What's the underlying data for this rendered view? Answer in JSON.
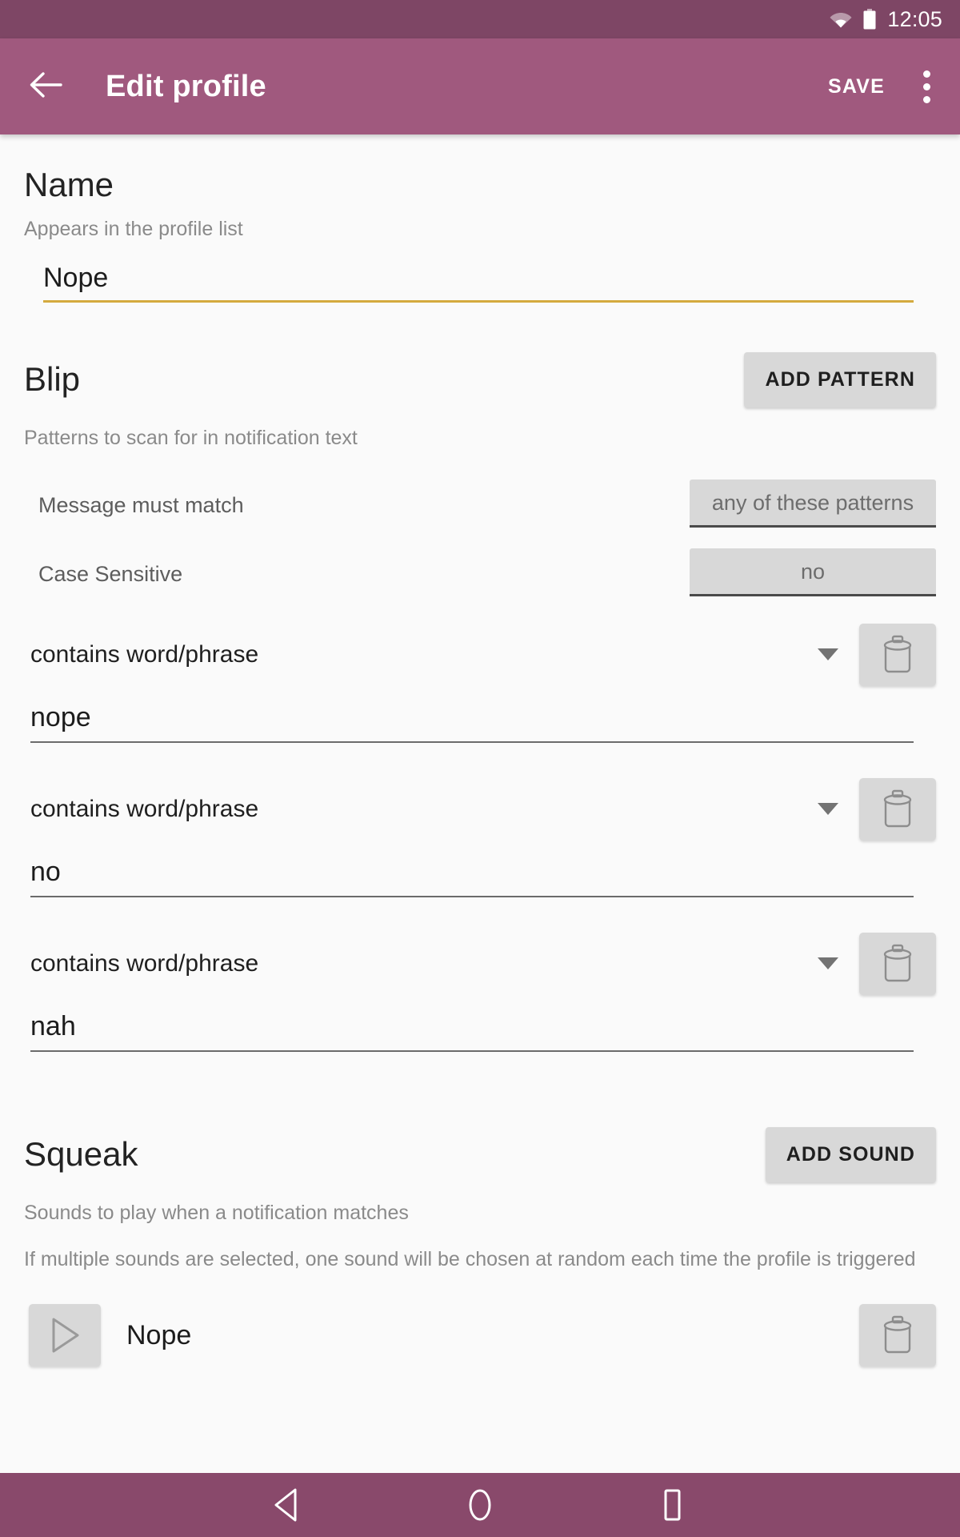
{
  "status_bar": {
    "time": "12:05",
    "wifi_icon": "wifi-icon",
    "battery_icon": "battery-icon"
  },
  "app_bar": {
    "back_icon": "back-arrow-icon",
    "title": "Edit profile",
    "save_label": "SAVE",
    "overflow_icon": "overflow-menu-icon",
    "background_color": "#a0597e"
  },
  "name_section": {
    "title": "Name",
    "subtitle": "Appears in the profile list",
    "value": "Nope",
    "placeholder": "Name",
    "underline_color": "#d4aa3e"
  },
  "blip_section": {
    "title": "Blip",
    "add_button_label": "ADD PATTERN",
    "subtitle": "Patterns to scan for in notification text",
    "settings": [
      {
        "label": "Message must match",
        "value": "any of these patterns"
      },
      {
        "label": "Case Sensitive",
        "value": "no"
      }
    ],
    "patterns": [
      {
        "type": "contains word/phrase",
        "value": "nope",
        "delete_icon": "trash-icon",
        "caret_icon": "chevron-down-icon"
      },
      {
        "type": "contains word/phrase",
        "value": "no",
        "delete_icon": "trash-icon",
        "caret_icon": "chevron-down-icon"
      },
      {
        "type": "contains word/phrase",
        "value": "nah",
        "delete_icon": "trash-icon",
        "caret_icon": "chevron-down-icon"
      }
    ]
  },
  "squeak_section": {
    "title": "Squeak",
    "add_button_label": "ADD SOUND",
    "subtitle": "Sounds to play when a notification matches",
    "note": "If multiple sounds are selected, one sound will be chosen at random each time the profile is triggered",
    "sounds": [
      {
        "name": "Nope",
        "play_icon": "play-icon",
        "delete_icon": "trash-icon"
      }
    ]
  },
  "nav_bar": {
    "back_icon": "nav-back-icon",
    "home_icon": "nav-home-icon",
    "recents_icon": "nav-recents-icon",
    "background_color": "#89496b"
  }
}
